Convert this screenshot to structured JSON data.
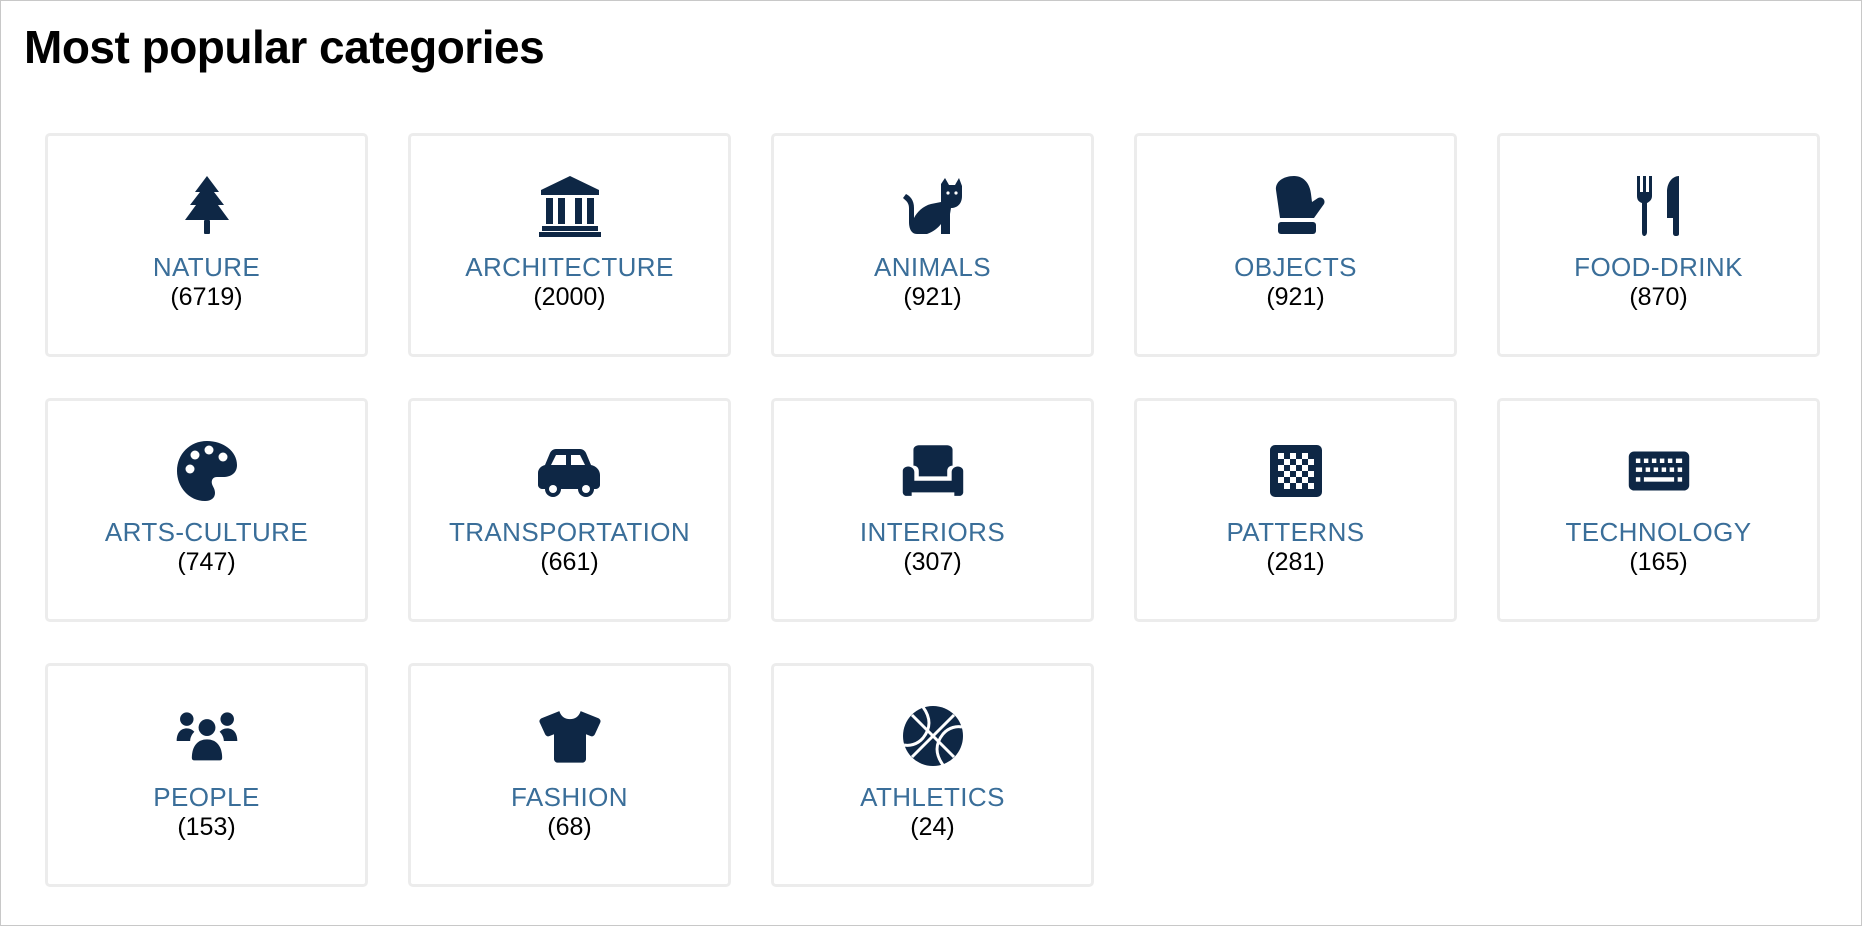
{
  "page": {
    "title": "Most popular categories"
  },
  "colors": {
    "icon": "#0e2745",
    "label": "#3a6e99",
    "count": "#000000",
    "card_border": "#ececec"
  },
  "categories": [
    {
      "label": "NATURE",
      "count": "(6719)",
      "icon": "tree-icon"
    },
    {
      "label": "ARCHITECTURE",
      "count": "(2000)",
      "icon": "landmark-icon"
    },
    {
      "label": "ANIMALS",
      "count": "(921)",
      "icon": "cat-icon"
    },
    {
      "label": "OBJECTS",
      "count": "(921)",
      "icon": "mitten-icon"
    },
    {
      "label": "FOOD-DRINK",
      "count": "(870)",
      "icon": "utensils-icon"
    },
    {
      "label": "ARTS-CULTURE",
      "count": "(747)",
      "icon": "palette-icon"
    },
    {
      "label": "TRANSPORTATION",
      "count": "(661)",
      "icon": "car-icon"
    },
    {
      "label": "INTERIORS",
      "count": "(307)",
      "icon": "couch-icon"
    },
    {
      "label": "PATTERNS",
      "count": "(281)",
      "icon": "chess-board-icon"
    },
    {
      "label": "TECHNOLOGY",
      "count": "(165)",
      "icon": "keyboard-icon"
    },
    {
      "label": "PEOPLE",
      "count": "(153)",
      "icon": "people-group-icon"
    },
    {
      "label": "FASHION",
      "count": "(68)",
      "icon": "shirt-icon"
    },
    {
      "label": "ATHLETICS",
      "count": "(24)",
      "icon": "basketball-icon"
    }
  ]
}
